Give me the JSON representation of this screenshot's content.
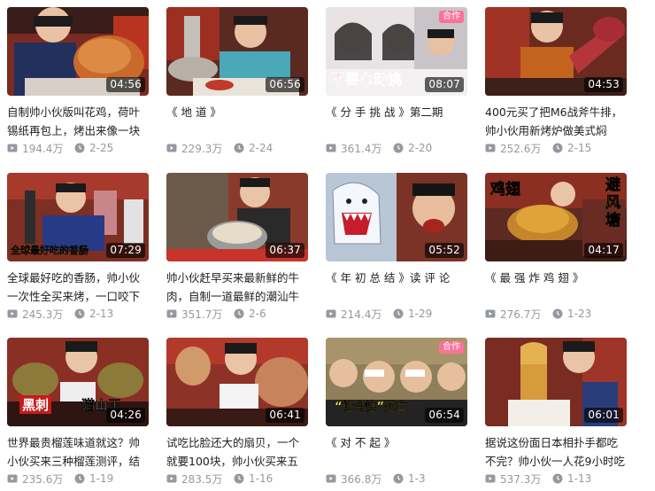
{
  "colors": {
    "accent": "#fb7299",
    "meta": "#9499a0",
    "title": "#212121"
  },
  "icons": {
    "views": "play-count-icon",
    "date": "clock-icon"
  },
  "videos": [
    {
      "title": "自制帅小伙版叫花鸡，荷叶锡纸再包上，烤出来像一块恐龙",
      "duration": "04:56",
      "views": "194.4万",
      "date": "2-25",
      "badge": "",
      "overlay": ""
    },
    {
      "title": "《 地 道 》",
      "duration": "06:56",
      "views": "229.3万",
      "date": "2-24",
      "badge": "",
      "overlay": ""
    },
    {
      "title": "《 分 手 挑 战 》第二期",
      "duration": "08:07",
      "views": "361.4万",
      "date": "2-20",
      "badge": "合作",
      "overlay": "不要心动挑"
    },
    {
      "title": "400元买了把M6战斧牛排，帅小伙用新烤炉做美式焖烤，",
      "duration": "04:53",
      "views": "252.6万",
      "date": "2-15",
      "badge": "",
      "overlay": ""
    },
    {
      "title": "全球最好吃的香肠，帅小伙一次性全买来烤，一口咬下汁水",
      "duration": "07:29",
      "views": "245.3万",
      "date": "2-13",
      "badge": "",
      "overlay": "全球最好吃的香肠"
    },
    {
      "title": "帅小伙赶早买来最新鲜的牛肉，自制一道最鲜的潮汕牛肉",
      "duration": "06:37",
      "views": "351.7万",
      "date": "2-6",
      "badge": "",
      "overlay": ""
    },
    {
      "title": "《 年 初 总 结 》读 评 论",
      "duration": "05:52",
      "views": "214.4万",
      "date": "1-29",
      "badge": "",
      "overlay": ""
    },
    {
      "title": "《 最 强 炸 鸡 翅 》",
      "duration": "04:17",
      "views": "276.7万",
      "date": "1-23",
      "badge": "",
      "overlay": "鸡翅"
    },
    {
      "title": "世界最贵榴莲味道就这？帅小伙买来三种榴莲测评，结果出",
      "duration": "04:26",
      "views": "235.6万",
      "date": "1-19",
      "badge": "",
      "overlay": "黑刺"
    },
    {
      "title": "试吃比脸还大的扇贝，一个就要100块，帅小伙买来五个做",
      "duration": "06:41",
      "views": "283.5万",
      "date": "1-16",
      "badge": "",
      "overlay": ""
    },
    {
      "title": "《 对 不 起 》",
      "duration": "06:54",
      "views": "366.8万",
      "date": "1-3",
      "badge": "合作",
      "overlay": "“社会性”死亡"
    },
    {
      "title": "据说这份面日本相扑手都吃不完？帅小伙一人花9小时吃",
      "duration": "06:01",
      "views": "537.3万",
      "date": "1-13",
      "badge": "",
      "overlay": ""
    }
  ],
  "extra_overlays": {
    "v5_cut": "猫山王",
    "v7_side": "避风塘"
  }
}
